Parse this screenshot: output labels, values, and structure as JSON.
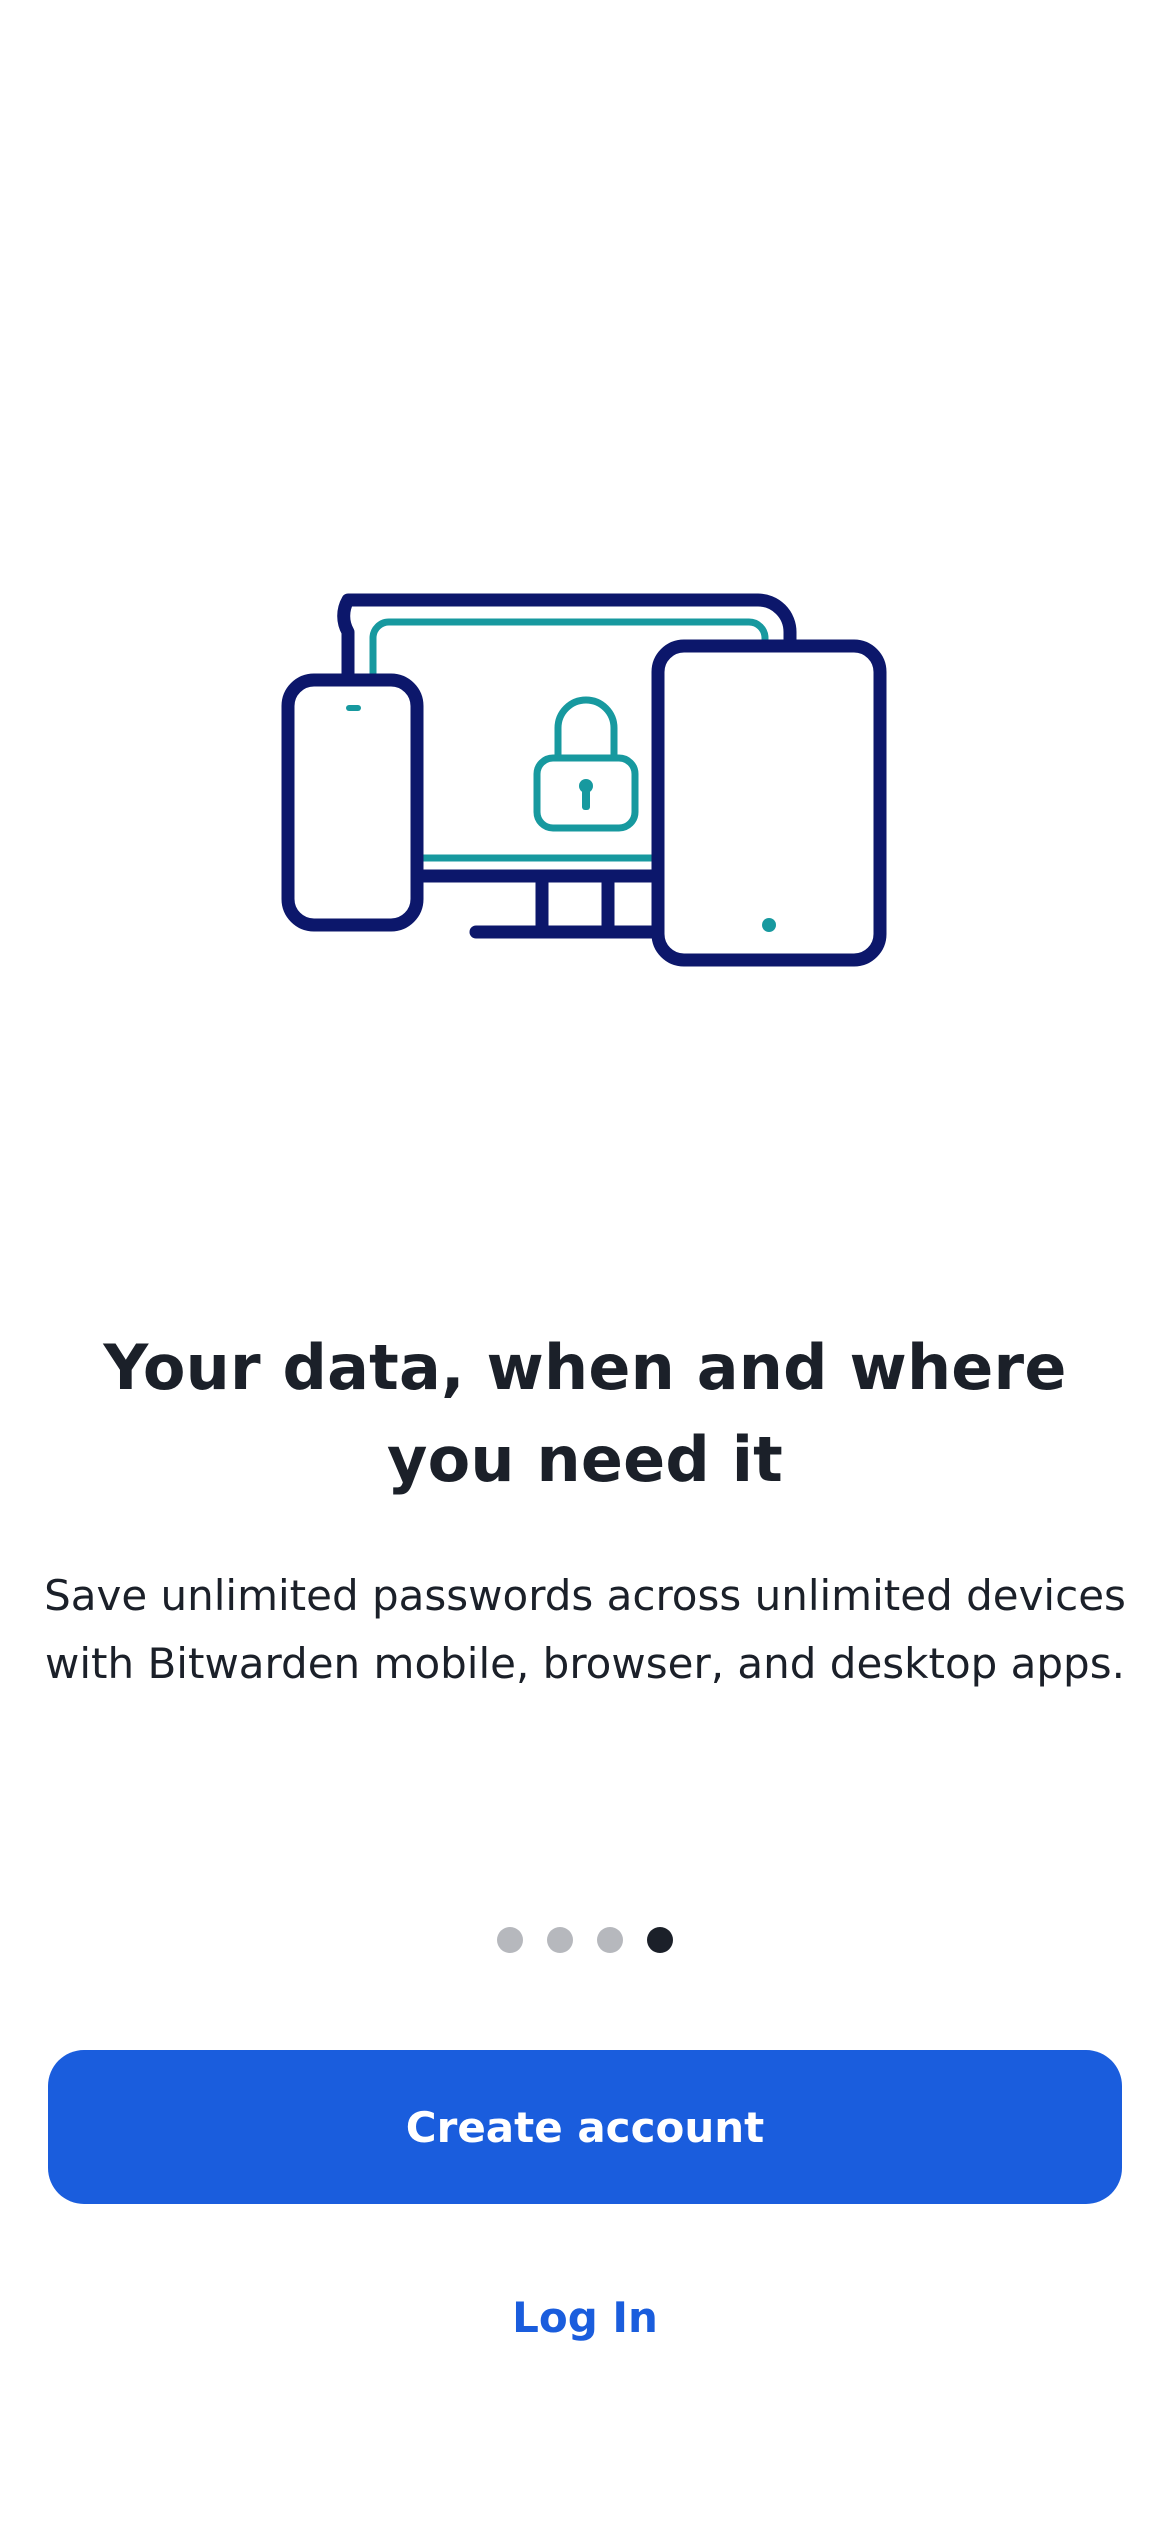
{
  "onboarding": {
    "illustration_icon": "devices-lock-illustration",
    "title": "Your data, when and where you need it",
    "subtitle": "Save unlimited passwords across unlimited devices with Bitwarden mobile, browser, and desktop apps.",
    "pager": {
      "total": 4,
      "current": 4
    }
  },
  "actions": {
    "create_account_label": "Create account",
    "login_label": "Log In"
  },
  "colors": {
    "primary": "#1a5ddd",
    "illustration_navy": "#0c176b",
    "illustration_teal": "#17999f",
    "text": "#1b2029",
    "dot_inactive": "#b6b8bd",
    "dot_active": "#1b2029"
  }
}
